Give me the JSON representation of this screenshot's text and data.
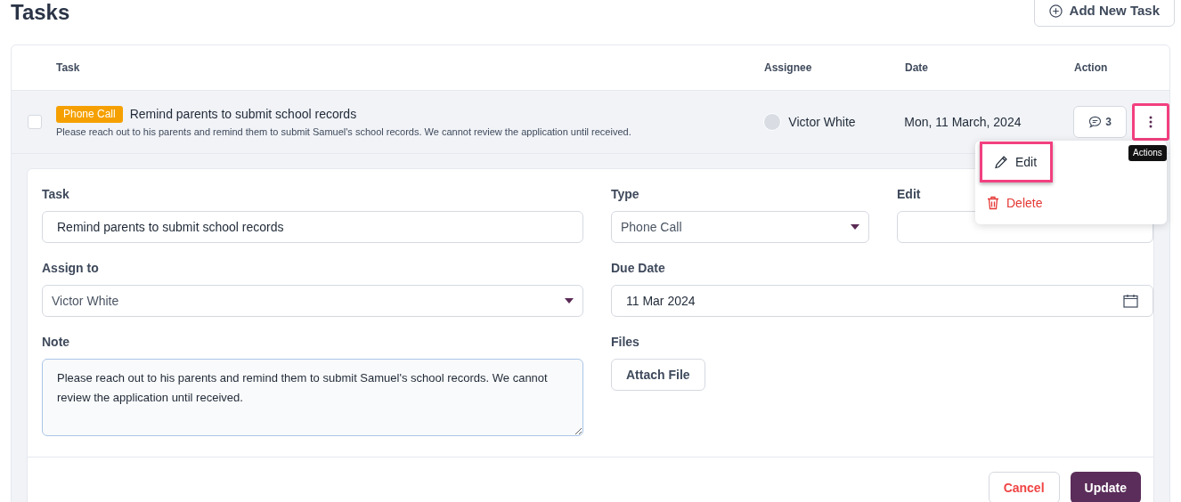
{
  "page_title": "Tasks",
  "add_button": "Add New Task",
  "table": {
    "columns": [
      "Task",
      "Assignee",
      "Date",
      "Action"
    ],
    "rows": [
      {
        "checked": false,
        "type_tag": "Phone Call",
        "title": "Remind parents to submit school records",
        "description": "Please reach out to his parents and remind them to submit Samuel's school records. We cannot review the application until received.",
        "assignee": "Victor White",
        "date": "Mon, 11 March, 2024",
        "comments": "3",
        "expanded": true
      }
    ]
  },
  "actions_tooltip": "Actions",
  "actions_menu": [
    {
      "kind": "edit",
      "label": "Edit",
      "highlighted": true
    },
    {
      "kind": "delete",
      "label": "Delete",
      "highlighted": false
    }
  ],
  "form": {
    "task_label": "Task",
    "task_value": "Remind parents to submit school records",
    "type_label": "Type",
    "type_value": "Phone Call",
    "edit_label": "Edit",
    "assign_label": "Assign to",
    "assign_value": "Victor White",
    "due_label": "Due Date",
    "due_value": "11 Mar 2024",
    "note_label": "Note",
    "note_value": "Please reach out to his parents and remind them to submit Samuel's school records. We cannot review the application until received.",
    "files_label": "Files",
    "attach_button": "Attach File",
    "cancel_button": "Cancel",
    "update_button": "Update"
  }
}
